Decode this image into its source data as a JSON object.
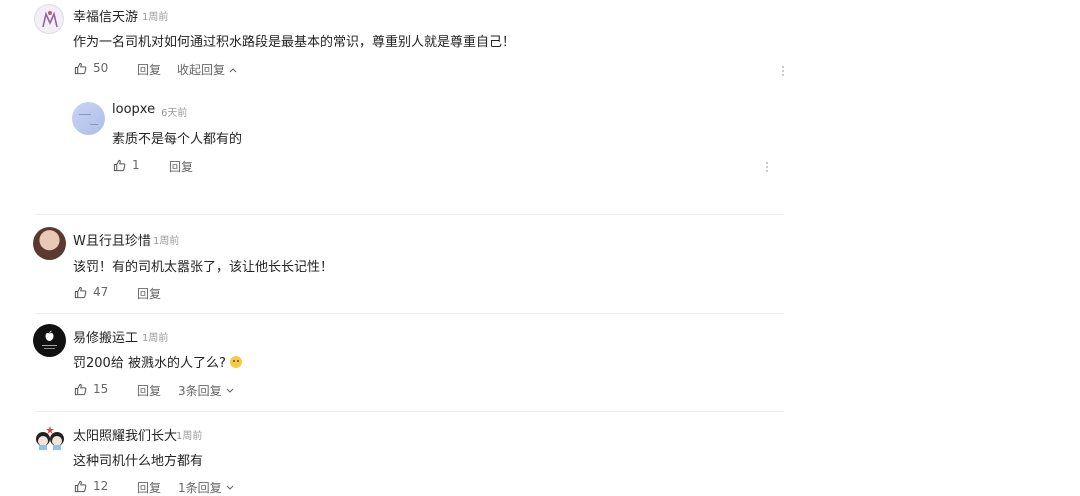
{
  "comments": [
    {
      "name": "幸福信天游",
      "time": "1周前",
      "text": "作为一名司机对如何通过积水路段是最基本的常识，尊重别人就是尊重自己！",
      "likes": "50",
      "reply_label": "回复",
      "collapse_label": "收起回复"
    },
    {
      "name": "W且行且珍惜",
      "time": "1周前",
      "text": "该罚！有的司机太嚣张了，该让他长长记性！",
      "likes": "47",
      "reply_label": "回复"
    },
    {
      "name": "易修搬运工",
      "time": "1周前",
      "text": "罚200给 被溅水的人了么?",
      "likes": "15",
      "reply_label": "回复",
      "replies_label": "3条回复"
    },
    {
      "name": "太阳照耀我们长大",
      "time": "1周前",
      "text": "这种司机什么地方都有",
      "likes": "12",
      "reply_label": "回复",
      "replies_label": "1条回复"
    }
  ],
  "reply": {
    "name": "loopxe",
    "time": "6天前",
    "text": "素质不是每个人都有的",
    "likes": "1",
    "reply_label": "回复"
  },
  "colors": {
    "text": "#222222",
    "meta": "#999999",
    "action": "#666666",
    "divider": "#eeeeee"
  }
}
